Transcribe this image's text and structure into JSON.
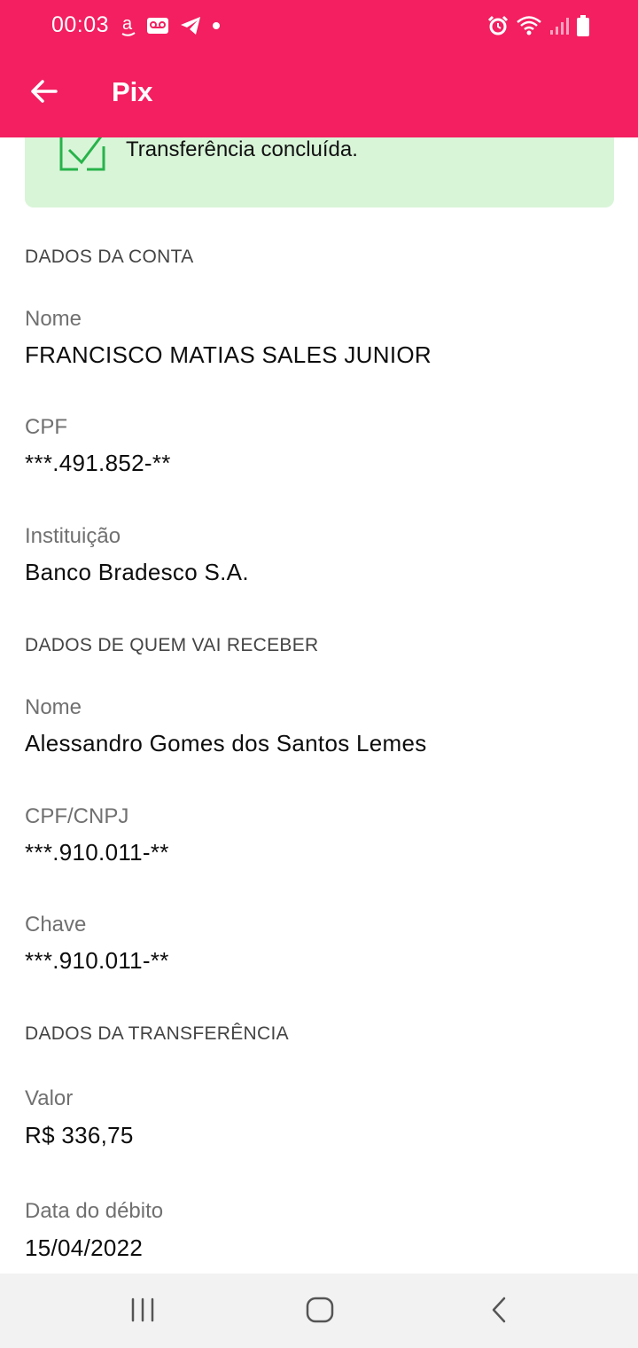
{
  "status_bar": {
    "time": "00:03",
    "left_icons": [
      "amazon-icon",
      "voicemail-icon",
      "telegram-icon",
      "dot-icon"
    ],
    "right_icons": [
      "alarm-icon",
      "wifi-icon",
      "signal-icon",
      "battery-icon"
    ]
  },
  "app_bar": {
    "title": "Pix",
    "back_icon": "arrow-left-icon"
  },
  "banner": {
    "text": "Transferência concluída.",
    "icon": "check-icon",
    "background": "#d9f5d8",
    "icon_color": "#28b34a"
  },
  "sections": {
    "conta": {
      "title": "DADOS DA CONTA",
      "nome_label": "Nome",
      "nome_value": "FRANCISCO MATIAS SALES JUNIOR",
      "cpf_label": "CPF",
      "cpf_value": "***.491.852-**",
      "instituicao_label": "Instituição",
      "instituicao_value": "Banco Bradesco S.A."
    },
    "recebedor": {
      "title": "DADOS DE QUEM VAI RECEBER",
      "nome_label": "Nome",
      "nome_value": "Alessandro Gomes dos Santos Lemes",
      "cpf_cnpj_label": "CPF/CNPJ",
      "cpf_cnpj_value": "***.910.011-**",
      "chave_label": "Chave",
      "chave_value": "***.910.011-**"
    },
    "transferencia": {
      "title": "DADOS DA TRANSFERÊNCIA",
      "valor_label": "Valor",
      "valor_value": "R$ 336,75",
      "data_label": "Data do débito",
      "data_value": "15/04/2022"
    }
  },
  "nav_bar": {
    "icons": [
      "recent-apps-icon",
      "home-icon",
      "back-icon"
    ]
  },
  "colors": {
    "brand": "#f31f60",
    "nav_background": "#f2f2f2"
  }
}
